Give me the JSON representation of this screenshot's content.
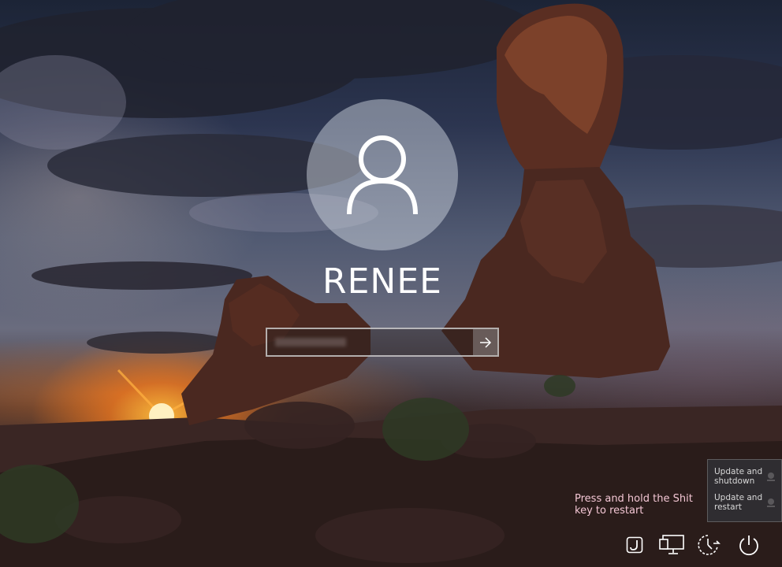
{
  "user": {
    "name": "RENEE",
    "avatar_icon": "user-icon"
  },
  "password": {
    "value": "",
    "placeholder": "",
    "submit_icon": "arrow-right-icon"
  },
  "hint": {
    "text": "Press and hold the Shit key to restart"
  },
  "power_menu": {
    "items": [
      {
        "label": "Update and shutdown"
      },
      {
        "label": "Update and restart"
      }
    ]
  },
  "tray": {
    "icons": [
      "ease-of-access-icon",
      "network-icon",
      "accessibility-icon",
      "power-icon"
    ]
  },
  "colors": {
    "hint_text": "#f3c6d4",
    "menu_bg": "#303034",
    "username": "#ffffff"
  }
}
